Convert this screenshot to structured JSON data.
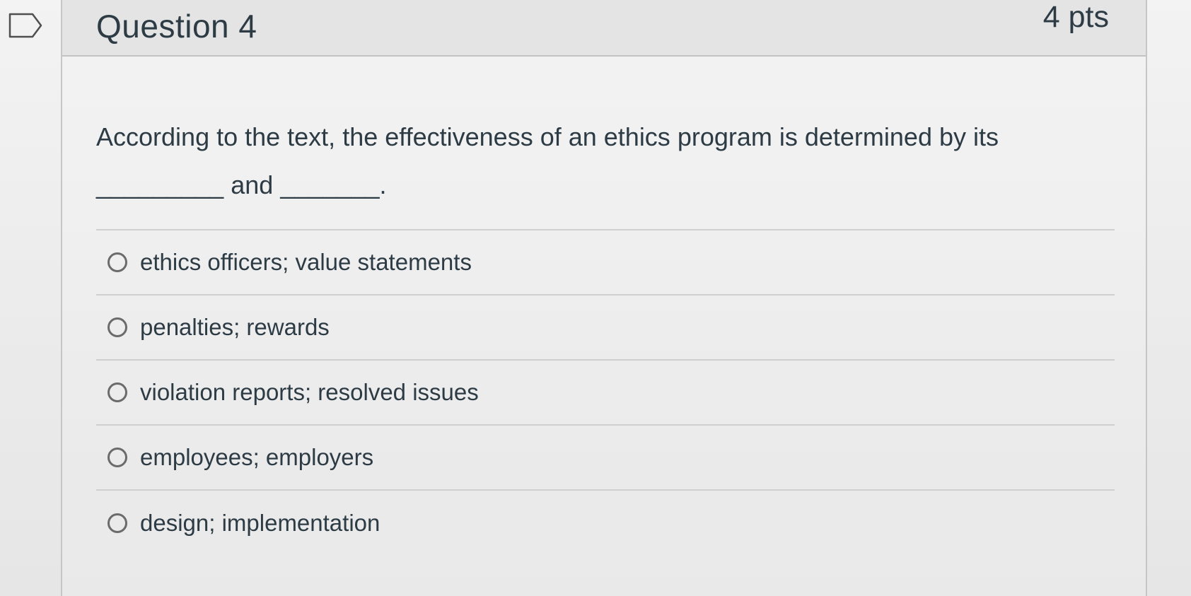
{
  "question": {
    "title": "Question 4",
    "points": "4 pts",
    "text_part1": "According to the text, the effectiveness of an ethics program is determined by its",
    "blank1": "_________",
    "text_part2": "and",
    "blank2": "_______",
    "text_end": "."
  },
  "answers": [
    {
      "label": "ethics officers; value statements",
      "selected": false
    },
    {
      "label": "penalties; rewards",
      "selected": false
    },
    {
      "label": "violation reports; resolved issues",
      "selected": false
    },
    {
      "label": "employees; employers",
      "selected": false
    },
    {
      "label": "design; implementation",
      "selected": false
    }
  ],
  "icons": {
    "flag": "flag-question-icon"
  },
  "colors": {
    "text": "#2d3b45",
    "header_bg": "#e4e4e4",
    "divider": "#cfcfcf"
  }
}
